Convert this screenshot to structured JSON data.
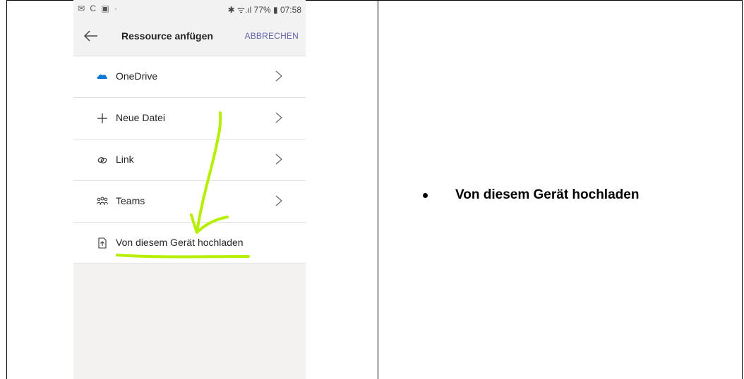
{
  "status_bar": {
    "left_icons": "✉ C ▣ ·",
    "right_text": "✱ ᯤ.ıl 77% ▮ 07:58"
  },
  "app_bar": {
    "title": "Ressource anfügen",
    "cancel_label": "ABBRECHEN"
  },
  "list": {
    "items": [
      {
        "label": "OneDrive",
        "icon": "onedrive-cloud-icon",
        "has_chevron": true
      },
      {
        "label": "Neue Datei",
        "icon": "plus-icon",
        "has_chevron": true
      },
      {
        "label": "Link",
        "icon": "link-icon",
        "has_chevron": true
      },
      {
        "label": "Teams",
        "icon": "teams-people-icon",
        "has_chevron": true
      },
      {
        "label": "Von diesem Gerät hochladen",
        "icon": "upload-file-icon",
        "has_chevron": false
      }
    ]
  },
  "side_note": {
    "bullet_text": "Von diesem Gerät hochladen"
  },
  "colors": {
    "accent": "#6264a7",
    "onedrive": "#0f78d4",
    "annotation": "#b6f000"
  }
}
